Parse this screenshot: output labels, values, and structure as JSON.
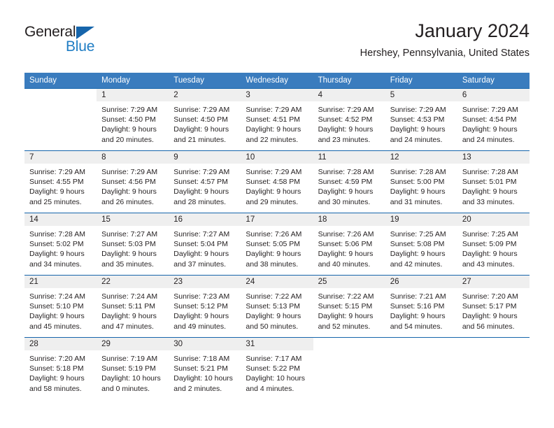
{
  "brand": {
    "name_part1": "General",
    "name_part2": "Blue",
    "logo_icon": "triangle-logo-icon",
    "colors": {
      "accent": "#1f7dc4",
      "triangle": "#1665ab",
      "text": "#231f20"
    }
  },
  "header": {
    "title": "January 2024",
    "subtitle": "Hershey, Pennsylvania, United States"
  },
  "calendar": {
    "header_bg": "#3a7cbe",
    "row_divider": "#1665ab",
    "daynum_bg": "#efefef",
    "weekday_headers": [
      "Sunday",
      "Monday",
      "Tuesday",
      "Wednesday",
      "Thursday",
      "Friday",
      "Saturday"
    ],
    "weeks": [
      [
        {
          "day": "",
          "sunrise": "",
          "sunset": "",
          "daylight_line1": "",
          "daylight_line2": ""
        },
        {
          "day": "1",
          "sunrise": "Sunrise: 7:29 AM",
          "sunset": "Sunset: 4:50 PM",
          "daylight_line1": "Daylight: 9 hours",
          "daylight_line2": "and 20 minutes."
        },
        {
          "day": "2",
          "sunrise": "Sunrise: 7:29 AM",
          "sunset": "Sunset: 4:50 PM",
          "daylight_line1": "Daylight: 9 hours",
          "daylight_line2": "and 21 minutes."
        },
        {
          "day": "3",
          "sunrise": "Sunrise: 7:29 AM",
          "sunset": "Sunset: 4:51 PM",
          "daylight_line1": "Daylight: 9 hours",
          "daylight_line2": "and 22 minutes."
        },
        {
          "day": "4",
          "sunrise": "Sunrise: 7:29 AM",
          "sunset": "Sunset: 4:52 PM",
          "daylight_line1": "Daylight: 9 hours",
          "daylight_line2": "and 23 minutes."
        },
        {
          "day": "5",
          "sunrise": "Sunrise: 7:29 AM",
          "sunset": "Sunset: 4:53 PM",
          "daylight_line1": "Daylight: 9 hours",
          "daylight_line2": "and 24 minutes."
        },
        {
          "day": "6",
          "sunrise": "Sunrise: 7:29 AM",
          "sunset": "Sunset: 4:54 PM",
          "daylight_line1": "Daylight: 9 hours",
          "daylight_line2": "and 24 minutes."
        }
      ],
      [
        {
          "day": "7",
          "sunrise": "Sunrise: 7:29 AM",
          "sunset": "Sunset: 4:55 PM",
          "daylight_line1": "Daylight: 9 hours",
          "daylight_line2": "and 25 minutes."
        },
        {
          "day": "8",
          "sunrise": "Sunrise: 7:29 AM",
          "sunset": "Sunset: 4:56 PM",
          "daylight_line1": "Daylight: 9 hours",
          "daylight_line2": "and 26 minutes."
        },
        {
          "day": "9",
          "sunrise": "Sunrise: 7:29 AM",
          "sunset": "Sunset: 4:57 PM",
          "daylight_line1": "Daylight: 9 hours",
          "daylight_line2": "and 28 minutes."
        },
        {
          "day": "10",
          "sunrise": "Sunrise: 7:29 AM",
          "sunset": "Sunset: 4:58 PM",
          "daylight_line1": "Daylight: 9 hours",
          "daylight_line2": "and 29 minutes."
        },
        {
          "day": "11",
          "sunrise": "Sunrise: 7:28 AM",
          "sunset": "Sunset: 4:59 PM",
          "daylight_line1": "Daylight: 9 hours",
          "daylight_line2": "and 30 minutes."
        },
        {
          "day": "12",
          "sunrise": "Sunrise: 7:28 AM",
          "sunset": "Sunset: 5:00 PM",
          "daylight_line1": "Daylight: 9 hours",
          "daylight_line2": "and 31 minutes."
        },
        {
          "day": "13",
          "sunrise": "Sunrise: 7:28 AM",
          "sunset": "Sunset: 5:01 PM",
          "daylight_line1": "Daylight: 9 hours",
          "daylight_line2": "and 33 minutes."
        }
      ],
      [
        {
          "day": "14",
          "sunrise": "Sunrise: 7:28 AM",
          "sunset": "Sunset: 5:02 PM",
          "daylight_line1": "Daylight: 9 hours",
          "daylight_line2": "and 34 minutes."
        },
        {
          "day": "15",
          "sunrise": "Sunrise: 7:27 AM",
          "sunset": "Sunset: 5:03 PM",
          "daylight_line1": "Daylight: 9 hours",
          "daylight_line2": "and 35 minutes."
        },
        {
          "day": "16",
          "sunrise": "Sunrise: 7:27 AM",
          "sunset": "Sunset: 5:04 PM",
          "daylight_line1": "Daylight: 9 hours",
          "daylight_line2": "and 37 minutes."
        },
        {
          "day": "17",
          "sunrise": "Sunrise: 7:26 AM",
          "sunset": "Sunset: 5:05 PM",
          "daylight_line1": "Daylight: 9 hours",
          "daylight_line2": "and 38 minutes."
        },
        {
          "day": "18",
          "sunrise": "Sunrise: 7:26 AM",
          "sunset": "Sunset: 5:06 PM",
          "daylight_line1": "Daylight: 9 hours",
          "daylight_line2": "and 40 minutes."
        },
        {
          "day": "19",
          "sunrise": "Sunrise: 7:25 AM",
          "sunset": "Sunset: 5:08 PM",
          "daylight_line1": "Daylight: 9 hours",
          "daylight_line2": "and 42 minutes."
        },
        {
          "day": "20",
          "sunrise": "Sunrise: 7:25 AM",
          "sunset": "Sunset: 5:09 PM",
          "daylight_line1": "Daylight: 9 hours",
          "daylight_line2": "and 43 minutes."
        }
      ],
      [
        {
          "day": "21",
          "sunrise": "Sunrise: 7:24 AM",
          "sunset": "Sunset: 5:10 PM",
          "daylight_line1": "Daylight: 9 hours",
          "daylight_line2": "and 45 minutes."
        },
        {
          "day": "22",
          "sunrise": "Sunrise: 7:24 AM",
          "sunset": "Sunset: 5:11 PM",
          "daylight_line1": "Daylight: 9 hours",
          "daylight_line2": "and 47 minutes."
        },
        {
          "day": "23",
          "sunrise": "Sunrise: 7:23 AM",
          "sunset": "Sunset: 5:12 PM",
          "daylight_line1": "Daylight: 9 hours",
          "daylight_line2": "and 49 minutes."
        },
        {
          "day": "24",
          "sunrise": "Sunrise: 7:22 AM",
          "sunset": "Sunset: 5:13 PM",
          "daylight_line1": "Daylight: 9 hours",
          "daylight_line2": "and 50 minutes."
        },
        {
          "day": "25",
          "sunrise": "Sunrise: 7:22 AM",
          "sunset": "Sunset: 5:15 PM",
          "daylight_line1": "Daylight: 9 hours",
          "daylight_line2": "and 52 minutes."
        },
        {
          "day": "26",
          "sunrise": "Sunrise: 7:21 AM",
          "sunset": "Sunset: 5:16 PM",
          "daylight_line1": "Daylight: 9 hours",
          "daylight_line2": "and 54 minutes."
        },
        {
          "day": "27",
          "sunrise": "Sunrise: 7:20 AM",
          "sunset": "Sunset: 5:17 PM",
          "daylight_line1": "Daylight: 9 hours",
          "daylight_line2": "and 56 minutes."
        }
      ],
      [
        {
          "day": "28",
          "sunrise": "Sunrise: 7:20 AM",
          "sunset": "Sunset: 5:18 PM",
          "daylight_line1": "Daylight: 9 hours",
          "daylight_line2": "and 58 minutes."
        },
        {
          "day": "29",
          "sunrise": "Sunrise: 7:19 AM",
          "sunset": "Sunset: 5:19 PM",
          "daylight_line1": "Daylight: 10 hours",
          "daylight_line2": "and 0 minutes."
        },
        {
          "day": "30",
          "sunrise": "Sunrise: 7:18 AM",
          "sunset": "Sunset: 5:21 PM",
          "daylight_line1": "Daylight: 10 hours",
          "daylight_line2": "and 2 minutes."
        },
        {
          "day": "31",
          "sunrise": "Sunrise: 7:17 AM",
          "sunset": "Sunset: 5:22 PM",
          "daylight_line1": "Daylight: 10 hours",
          "daylight_line2": "and 4 minutes."
        },
        {
          "day": "",
          "sunrise": "",
          "sunset": "",
          "daylight_line1": "",
          "daylight_line2": ""
        },
        {
          "day": "",
          "sunrise": "",
          "sunset": "",
          "daylight_line1": "",
          "daylight_line2": ""
        },
        {
          "day": "",
          "sunrise": "",
          "sunset": "",
          "daylight_line1": "",
          "daylight_line2": ""
        }
      ]
    ]
  }
}
